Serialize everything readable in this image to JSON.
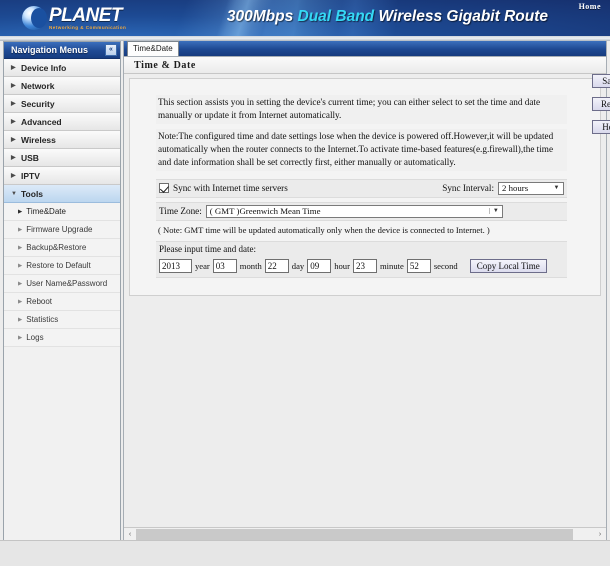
{
  "banner": {
    "logo_word": "PLANET",
    "logo_tagline": "Networking & Communication",
    "title_prefix": "300Mbps ",
    "title_accent": "Dual Band",
    "title_suffix": " Wireless Gigabit Route",
    "home_label": "Home"
  },
  "sidebar": {
    "header_title": "Navigation Menus",
    "collapse_label": "«",
    "items": [
      {
        "label": "Device Info",
        "expanded": false
      },
      {
        "label": "Network",
        "expanded": false
      },
      {
        "label": "Security",
        "expanded": false
      },
      {
        "label": "Advanced",
        "expanded": false
      },
      {
        "label": "Wireless",
        "expanded": false
      },
      {
        "label": "USB",
        "expanded": false
      },
      {
        "label": "IPTV",
        "expanded": false
      },
      {
        "label": "Tools",
        "expanded": true
      }
    ],
    "tools_subitems": [
      {
        "label": "Time&Date",
        "current": true
      },
      {
        "label": "Firmware Upgrade",
        "current": false
      },
      {
        "label": "Backup&Restore",
        "current": false
      },
      {
        "label": "Restore to Default",
        "current": false
      },
      {
        "label": "User Name&Password",
        "current": false
      },
      {
        "label": "Reboot",
        "current": false
      },
      {
        "label": "Statistics",
        "current": false
      },
      {
        "label": "Logs",
        "current": false
      }
    ]
  },
  "content": {
    "tab_label": "Time&Date",
    "panel_title": "Time & Date",
    "description": "This section assists you in setting the device's current time; you can either select to set the time and date manually or update it from Internet automatically.",
    "note": "Note:The configured time and date settings lose when the device is powered off.However,it will be updated automatically when the router connects to the Internet.To activate time-based features(e.g.firewall),the time and date information shall be set correctly first, either manually or automatically.",
    "sync_checkbox_label": "Sync with Internet time servers",
    "sync_checkbox_checked": true,
    "sync_interval_label": "Sync Interval:",
    "sync_interval_value": "2 hours",
    "timezone_label": "Time Zone:",
    "timezone_value": "( GMT )Greenwich Mean Time",
    "gmt_note": "( Note: GMT time will be updated automatically only when the device is connected to Internet. )",
    "please_input_label": "Please input time and date:",
    "datetime": {
      "year_value": "2013",
      "year_unit": "year",
      "month_value": "03",
      "month_unit": "month",
      "day_value": "22",
      "day_unit": "day",
      "hour_value": "09",
      "hour_unit": "hour",
      "minute_value": "23",
      "minute_unit": "minute",
      "second_value": "52",
      "second_unit": "second"
    },
    "copy_local_time_label": "Copy Local Time"
  },
  "side_actions": {
    "save_label": "Save",
    "reset_label": "Reset",
    "help_label": "Help"
  },
  "scrollbar": {
    "left_arrow": "‹",
    "right_arrow": "›"
  },
  "colors": {
    "brand_blue": "#1d4a93",
    "accent_cyan": "#35d8f5",
    "logo_orange": "#f2a83c",
    "active_nav": "#bcd6ef"
  }
}
